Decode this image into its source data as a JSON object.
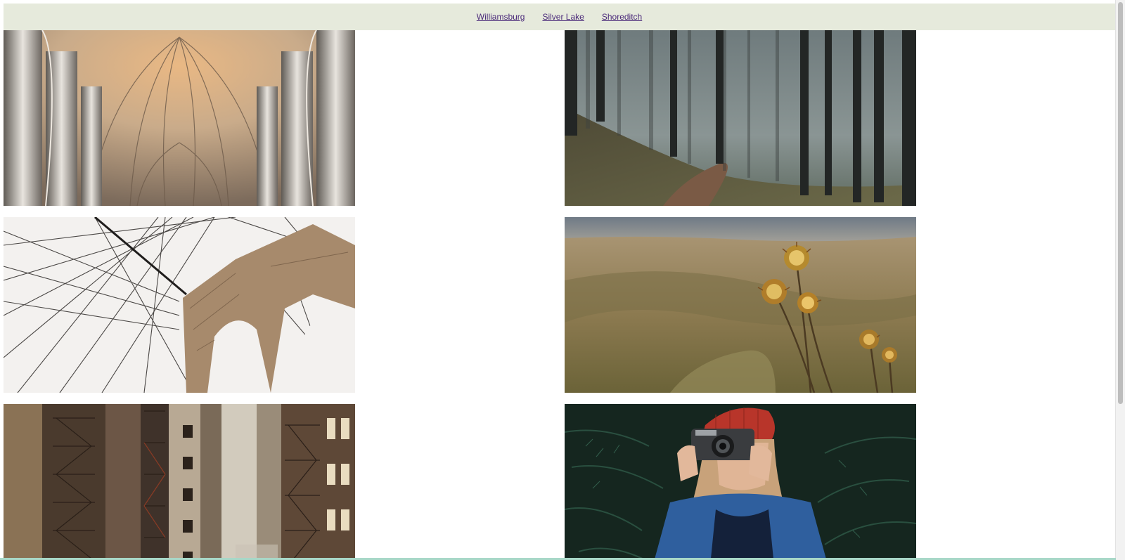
{
  "nav": {
    "links": [
      {
        "label": "Williamsburg"
      },
      {
        "label": "Silver Lake"
      },
      {
        "label": "Shoreditch"
      }
    ]
  },
  "gallery": {
    "images": [
      {
        "subject": "cathedral-vault"
      },
      {
        "subject": "foggy-forest-path"
      },
      {
        "subject": "bridge-cables"
      },
      {
        "subject": "thistle-valley"
      },
      {
        "subject": "fire-escape-buildings"
      },
      {
        "subject": "photographer-red-beanie"
      }
    ]
  }
}
